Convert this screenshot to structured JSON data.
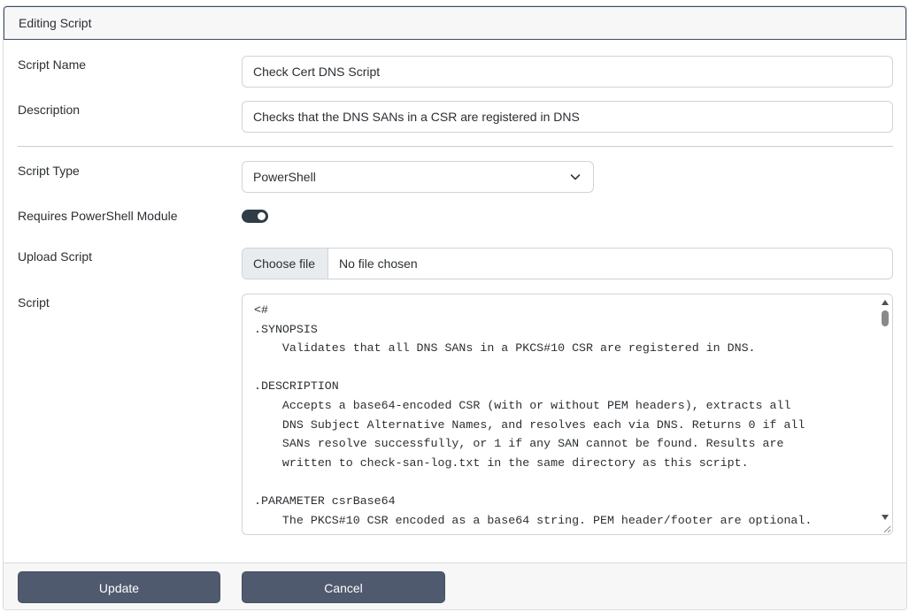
{
  "header": {
    "title": "Editing Script"
  },
  "form": {
    "script_name": {
      "label": "Script Name",
      "value": "Check Cert DNS Script"
    },
    "description": {
      "label": "Description",
      "value": "Checks that the DNS SANs in a CSR are registered in DNS"
    },
    "script_type": {
      "label": "Script Type",
      "selected": "PowerShell"
    },
    "requires_module": {
      "label": "Requires PowerShell Module",
      "checked": true
    },
    "upload": {
      "label": "Upload Script",
      "button": "Choose file",
      "status": "No file chosen"
    },
    "script": {
      "label": "Script",
      "content": "<#\n.SYNOPSIS\n    Validates that all DNS SANs in a PKCS#10 CSR are registered in DNS.\n\n.DESCRIPTION\n    Accepts a base64-encoded CSR (with or without PEM headers), extracts all\n    DNS Subject Alternative Names, and resolves each via DNS. Returns 0 if all\n    SANs resolve successfully, or 1 if any SAN cannot be found. Results are\n    written to check-san-log.txt in the same directory as this script.\n\n.PARAMETER csrBase64\n    The PKCS#10 CSR encoded as a base64 string. PEM header/footer are optional."
    }
  },
  "footer": {
    "update_label": "Update",
    "cancel_label": "Cancel"
  },
  "colors": {
    "primary_button": "#4f5a6e",
    "toggle_on": "#2f3d47",
    "header_border": "#3d4d67"
  },
  "icons": {
    "select": "chevron-down-icon",
    "scroll_up": "triangle-up-icon",
    "scroll_down": "triangle-down-icon"
  }
}
